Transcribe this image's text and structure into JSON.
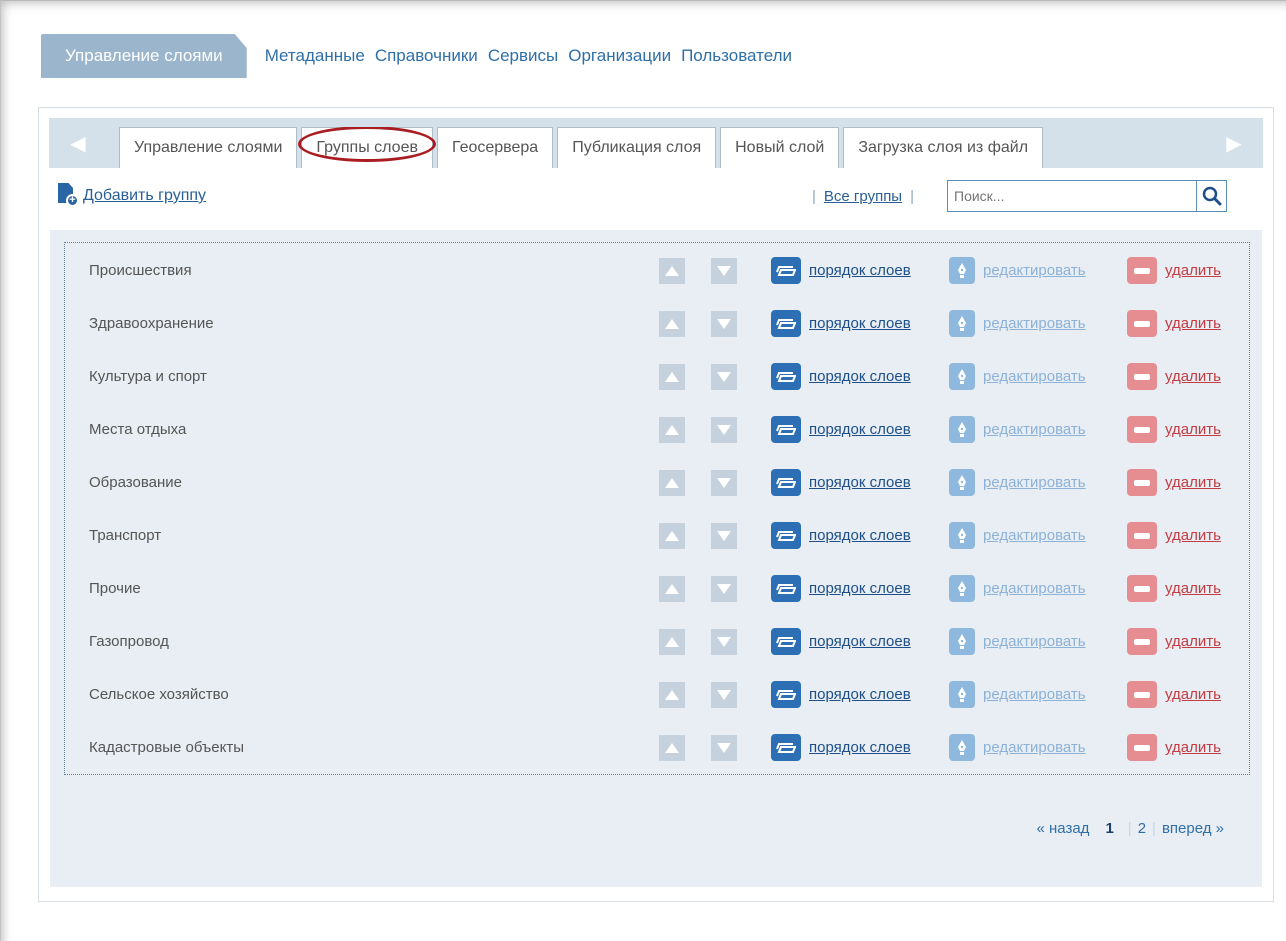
{
  "topnav": {
    "active": "Управление слоями",
    "links": [
      "Метаданные",
      "Справочники",
      "Сервисы",
      "Организации",
      "Пользователи"
    ]
  },
  "tabs": [
    "Управление слоями",
    "Группы слоев",
    "Геосервера",
    "Публикация слоя",
    "Новый слой",
    "Загрузка слоя из файл"
  ],
  "selected_tab": "Группы слоев",
  "toolbar": {
    "add_group": "Добавить группу",
    "all_groups": "Все группы",
    "search_placeholder": "Поиск..."
  },
  "groups": [
    "Происшествия",
    "Здравоохранение",
    "Культура и спорт",
    "Места отдыха",
    "Образование",
    "Транспорт",
    "Прочие",
    "Газопровод",
    "Сельское хозяйство",
    "Кадастровые объекты"
  ],
  "row_actions": {
    "order": "порядок слоев",
    "edit": "редактировать",
    "delete": "удалить"
  },
  "pager": {
    "prev": "« назад",
    "current": "1",
    "next_page": "2",
    "next": "вперед »"
  },
  "colors": {
    "accent": "#2d6fb5",
    "delete": "#e58d91",
    "edit": "#8eb8de",
    "highlight_ring": "#a91d22"
  }
}
